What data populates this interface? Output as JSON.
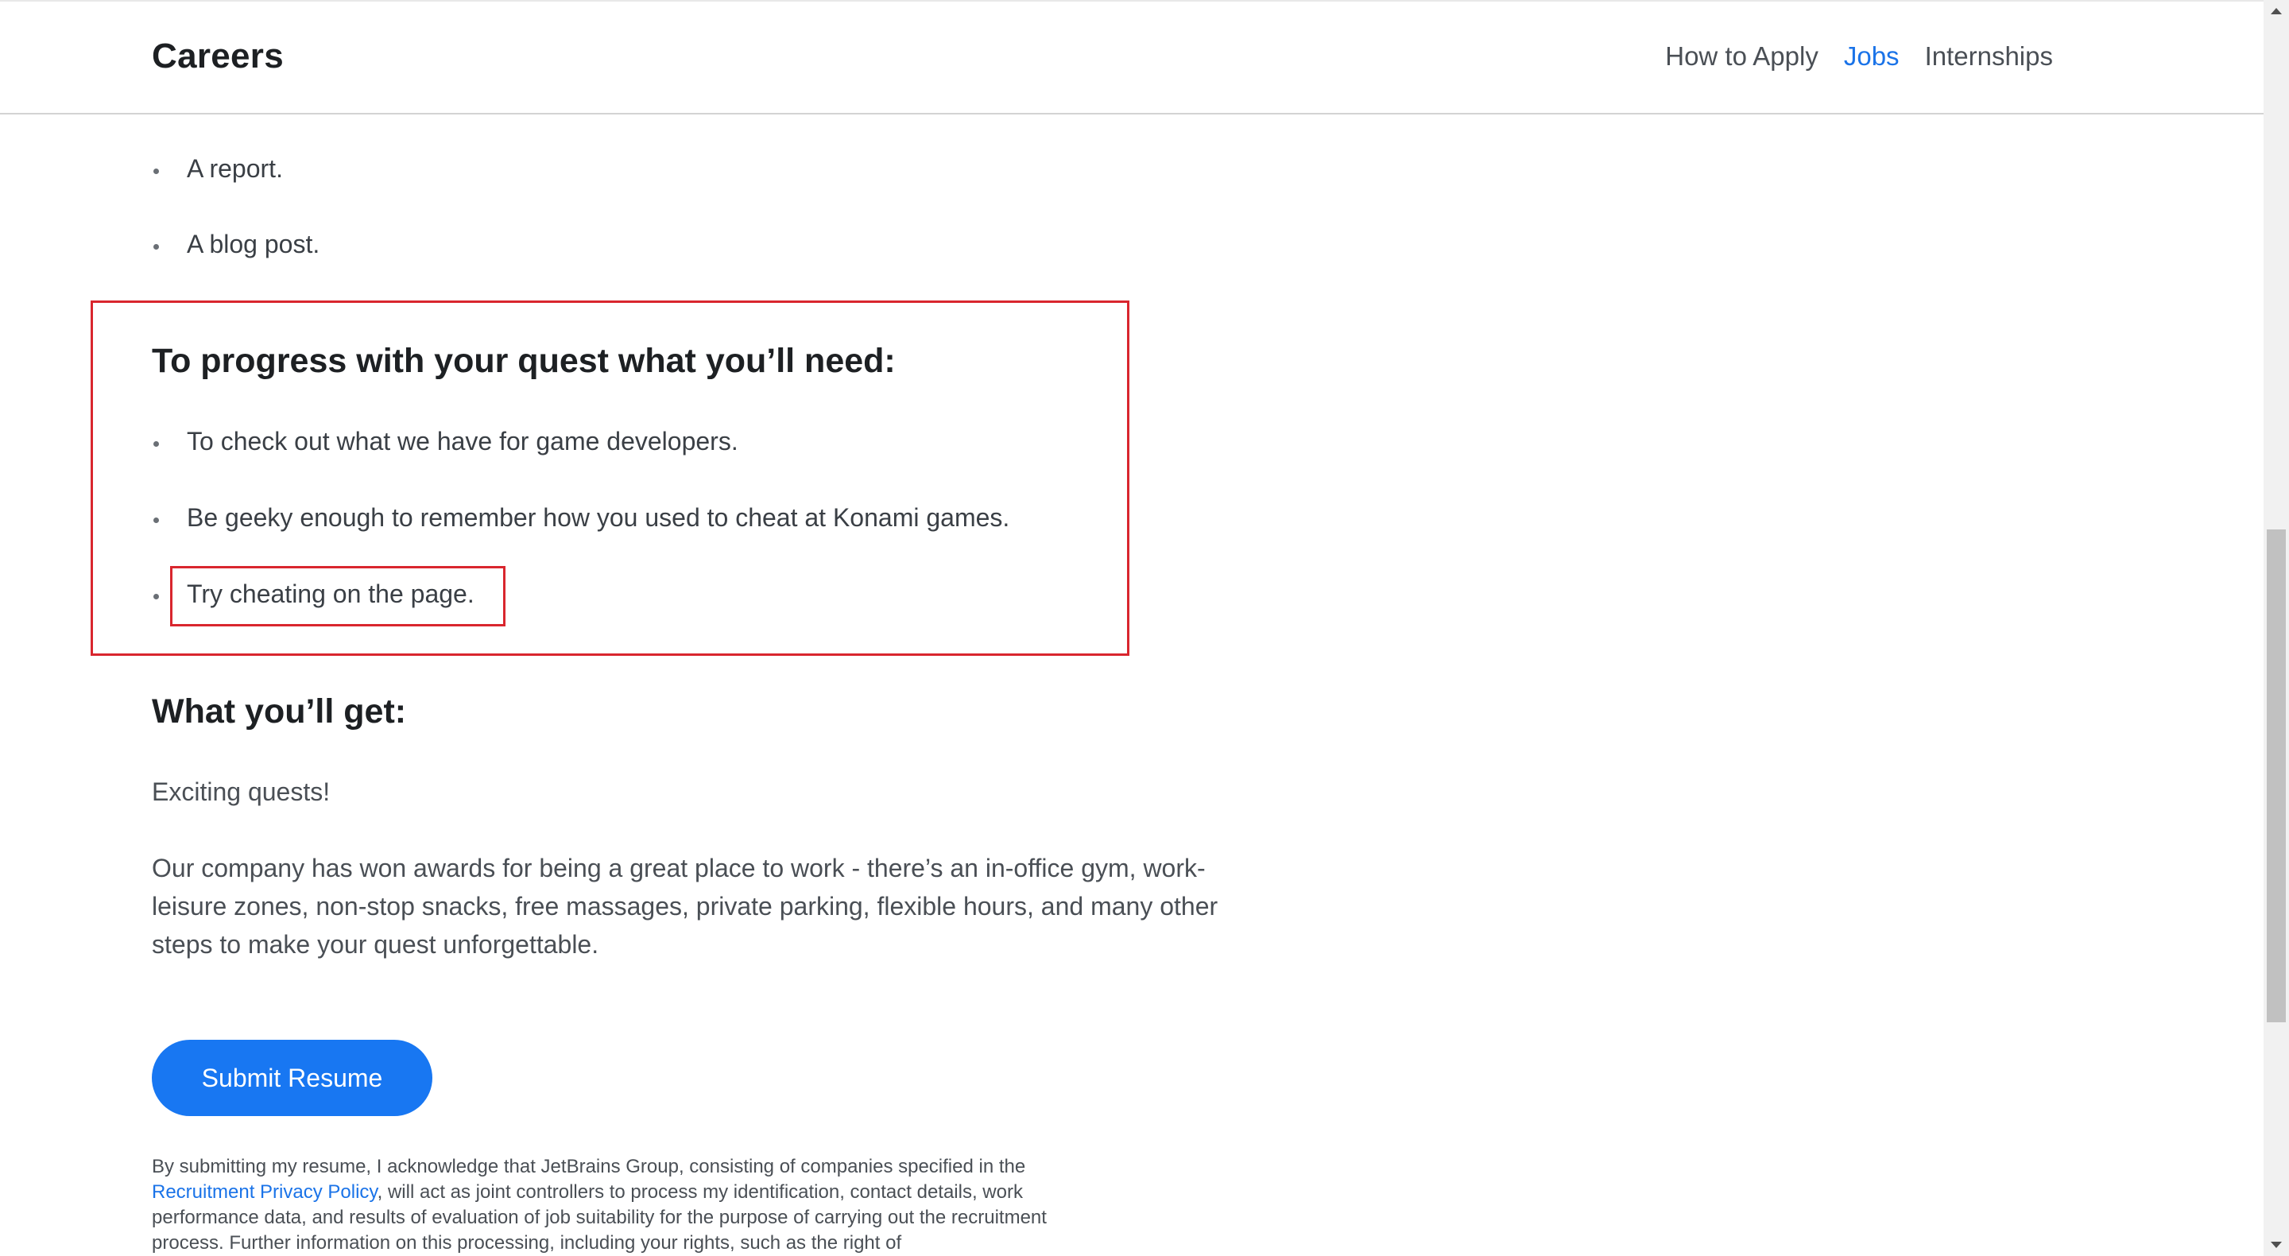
{
  "header": {
    "brand": "Careers",
    "nav": [
      {
        "label": "How to Apply",
        "active": false
      },
      {
        "label": "Jobs",
        "active": true
      },
      {
        "label": "Internships",
        "active": false
      }
    ]
  },
  "list_top": [
    "A report.",
    "A blog post."
  ],
  "need_section": {
    "heading": "To progress with your quest what you’ll need:",
    "items": [
      "To check out what we have for game developers.",
      "Be geeky enough to remember how you used to cheat at Konami games.",
      "Try cheating on the page."
    ]
  },
  "get_section": {
    "heading": "What you’ll get:",
    "para1": "Exciting quests!",
    "para2": "Our company has won awards for being a great place to work - there’s an in-office gym, work-leisure zones, non-stop snacks, free massages, private parking, flexible hours, and many other steps to make your quest unforgettable."
  },
  "submit_label": "Submit Resume",
  "legal": {
    "before_link": "By submitting my resume, I acknowledge that JetBrains Group, consisting of companies specified in the ",
    "link_text": "Recruitment Privacy Policy",
    "after_link": ", will act as joint controllers to process my identification, contact details, work performance data, and results of evaluation of job suitability for the purpose of carrying out the recruitment process. Further information on this processing, including your rights, such as the right of"
  },
  "colors": {
    "accent": "#1877f2",
    "link": "#1a73e8",
    "highlight": "#d9262e"
  }
}
